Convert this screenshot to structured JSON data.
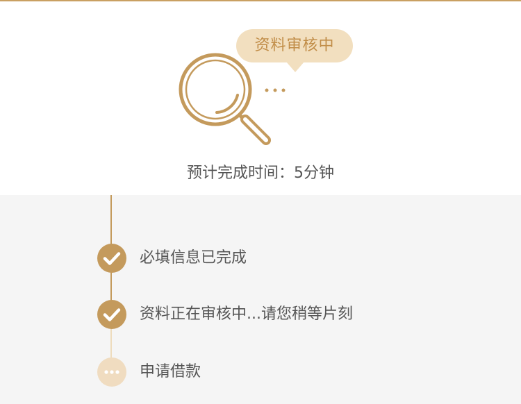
{
  "colors": {
    "accent": "#c49a5c",
    "accent_light": "#f0dcc0",
    "bubble_bg": "#f2dfbf",
    "bubble_text": "#c18d48",
    "text": "#555555",
    "page_bg": "#f5f5f5",
    "card_bg": "#ffffff"
  },
  "status": {
    "bubble_text": "资料审核中",
    "eta_text": "预计完成时间：5分钟",
    "icon": "magnifier-icon"
  },
  "steps": [
    {
      "label": "必填信息已完成",
      "state": "done",
      "icon": "check-icon"
    },
    {
      "label": "资料正在审核中...请您稍等片刻",
      "state": "done",
      "icon": "check-icon"
    },
    {
      "label": "申请借款",
      "state": "pending",
      "icon": "more-dots-icon"
    }
  ]
}
